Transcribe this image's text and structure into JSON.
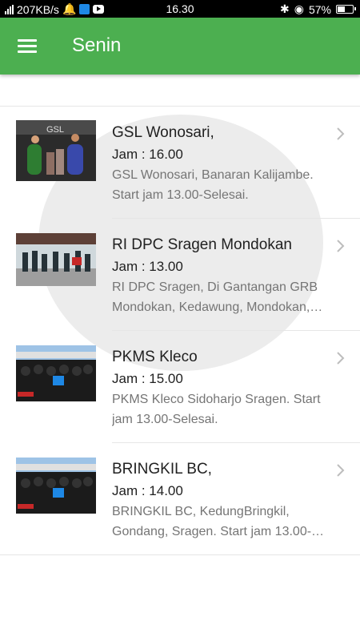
{
  "status_bar": {
    "network_speed": "207KB/s",
    "time": "16.30",
    "battery": "57%",
    "battery_level": 0.57,
    "icons": [
      "signal-icon",
      "notification-bell-icon",
      "wifi-icon",
      "youtube-icon",
      "bluetooth-icon",
      "eye-icon",
      "battery-icon"
    ]
  },
  "app_bar": {
    "title": "Senin",
    "menu_icon": "hamburger-menu-icon"
  },
  "events": [
    {
      "name": "GSL Wonosari,",
      "time": "Jam : 16.00",
      "description_lines": [
        "GSL Wonosari, Banaran Kalijambe.",
        "Start jam 13.00-Selesai."
      ]
    },
    {
      "name": "RI DPC Sragen Mondokan",
      "time": "Jam : 13.00",
      "description_lines": [
        "RI DPC Sragen, Di Gantangan GRB",
        "Mondokan, Kedawung, Mondokan,…"
      ]
    },
    {
      "name": "PKMS Kleco",
      "time": "Jam : 15.00",
      "description_lines": [
        "PKMS Kleco Sidoharjo Sragen. Start",
        "jam 13.00-Selesai."
      ]
    },
    {
      "name": "BRINGKIL BC,",
      "time": "Jam : 14.00",
      "description_lines": [
        "BRINGKIL BC, KedungBringkil,",
        "Gondang, Sragen. Start jam 13.00-…"
      ]
    }
  ],
  "colors": {
    "app_bar": "#4caf50",
    "status_bar": "#000000",
    "secondary_text": "#757575",
    "chevron": "#bdbdbd"
  }
}
